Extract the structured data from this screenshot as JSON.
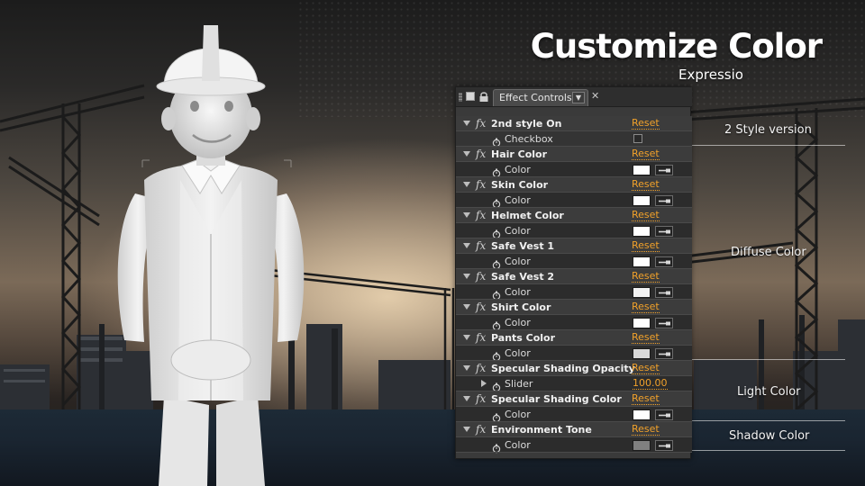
{
  "title": "Customize Color",
  "subtitle": "Expressio",
  "side_labels": {
    "style_version": "2 Style version",
    "diffuse": "Diffuse Color",
    "light": "Light Color",
    "shadow": "Shadow Color"
  },
  "panel": {
    "tab_label": "Effect Controls",
    "reset_label": "Reset",
    "properties": [
      {
        "name": "2nd style On",
        "sub": {
          "label": "Checkbox",
          "kind": "checkbox"
        }
      },
      {
        "name": "Hair Color",
        "sub": {
          "label": "Color",
          "kind": "color",
          "value": "#ffffff"
        }
      },
      {
        "name": "Skin Color",
        "sub": {
          "label": "Color",
          "kind": "color",
          "value": "#ffffff"
        }
      },
      {
        "name": "Helmet Color",
        "sub": {
          "label": "Color",
          "kind": "color",
          "value": "#ffffff"
        }
      },
      {
        "name": "Safe Vest 1",
        "sub": {
          "label": "Color",
          "kind": "color",
          "value": "#ffffff"
        }
      },
      {
        "name": "Safe Vest 2",
        "sub": {
          "label": "Color",
          "kind": "color",
          "value": "#f2f2f2"
        }
      },
      {
        "name": "Shirt Color",
        "sub": {
          "label": "Color",
          "kind": "color",
          "value": "#ffffff"
        }
      },
      {
        "name": "Pants Color",
        "sub": {
          "label": "Color",
          "kind": "color",
          "value": "#d9d9d9"
        }
      },
      {
        "name": "Specular Shading Opacity",
        "sub": {
          "label": "Slider",
          "kind": "slider",
          "value": "100.00"
        }
      },
      {
        "name": "Specular Shading Color",
        "sub": {
          "label": "Color",
          "kind": "color",
          "value": "#ffffff"
        }
      },
      {
        "name": "Environment Tone",
        "sub": {
          "label": "Color",
          "kind": "color",
          "value": "#808080"
        }
      }
    ]
  },
  "colors": {
    "reset_orange": "#f1a12a",
    "panel_bg": "#3a3a3a"
  }
}
